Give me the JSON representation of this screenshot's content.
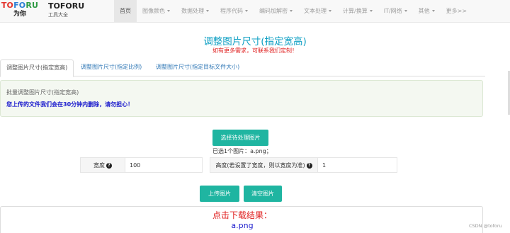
{
  "logo": {
    "part1": "TO",
    "part2": "FO",
    "part3": "RU",
    "sub": "为你"
  },
  "brand": {
    "name": "TOFORU",
    "tagline": "工具大全"
  },
  "nav": {
    "items": [
      {
        "label": "首页",
        "dropdown": false,
        "active": true
      },
      {
        "label": "图像颜色",
        "dropdown": true
      },
      {
        "label": "数据处理",
        "dropdown": true
      },
      {
        "label": "程序代码",
        "dropdown": true
      },
      {
        "label": "编码加解密",
        "dropdown": true
      },
      {
        "label": "文本处理",
        "dropdown": true
      },
      {
        "label": "计算/换算",
        "dropdown": true
      },
      {
        "label": "IT/网络",
        "dropdown": true
      },
      {
        "label": "其他",
        "dropdown": true
      },
      {
        "label": "更多>>",
        "dropdown": false
      }
    ]
  },
  "page": {
    "title": "调整图片尺寸(指定宽高)",
    "subtitle": "如有更多需求，可联系我们定制！"
  },
  "tabs": [
    {
      "label": "调整图片尺寸(指定宽高)",
      "active": true
    },
    {
      "label": "调整图片尺寸(指定比例)"
    },
    {
      "label": "调整图片尺寸(指定目标文件大小)"
    }
  ],
  "info": {
    "heading": "批量调整图片尺寸(指定宽高)",
    "notice": "您上传的文件我们会在30分钟内删除，请勿担心！"
  },
  "select_button": "选择待处理图片",
  "selected_text": "已选1个图片：a.png；",
  "form": {
    "width_label": "宽度",
    "width_value": "100",
    "height_label": "高度(若设置了宽度，则以宽度为准)",
    "height_value": "1",
    "help_icon_glyph": "?"
  },
  "upload_button": "上传图片",
  "clear_button": "清空图片",
  "result": {
    "title": "点击下载结果：",
    "file": "a.png"
  },
  "watermark": "CSDN @toforu",
  "colors": {
    "accent": "#1fb5a1",
    "title": "#0e9fc3",
    "alert": "#e02020",
    "link": "#337ab7"
  }
}
